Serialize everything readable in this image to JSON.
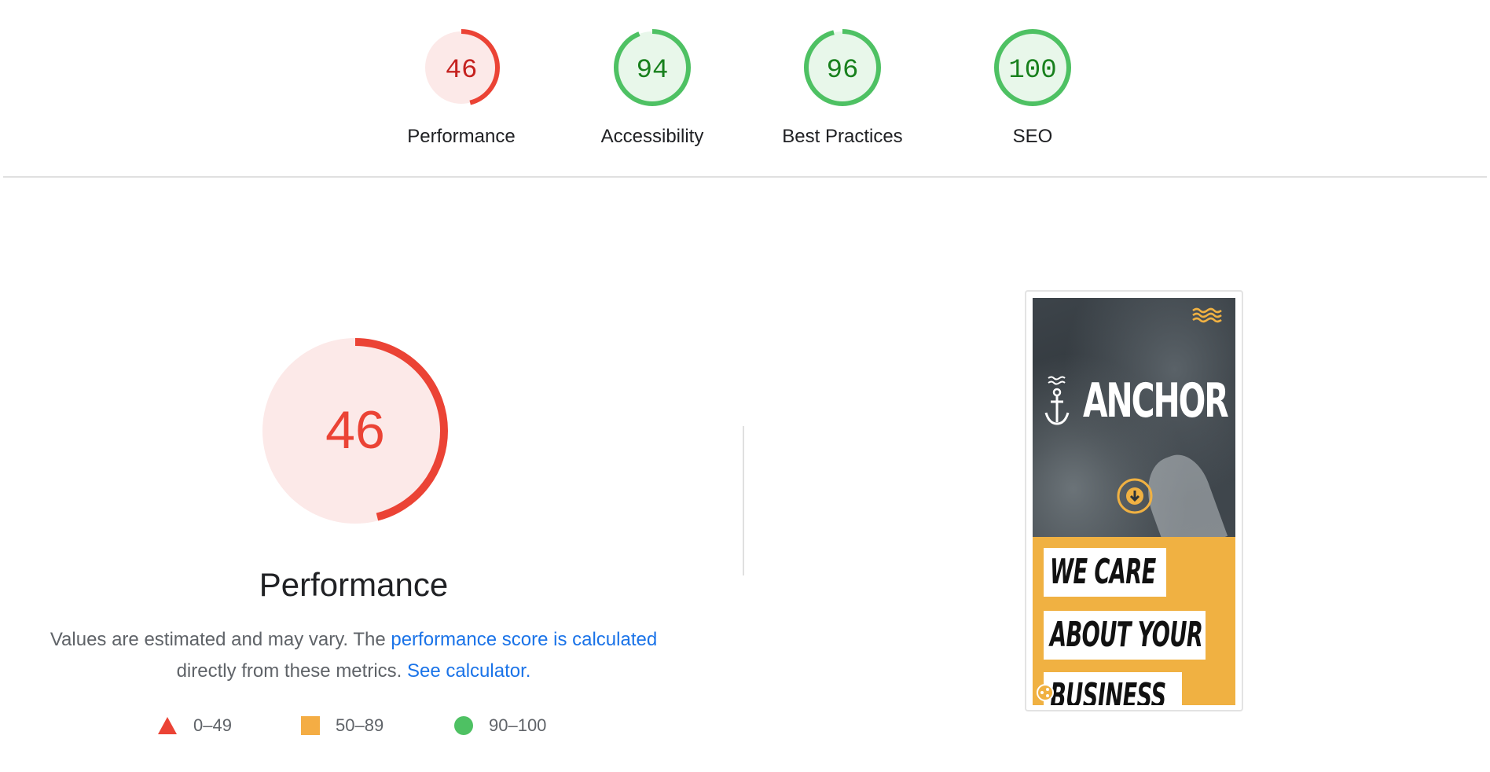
{
  "gauges": [
    {
      "label": "Performance",
      "score": "46",
      "value": 46,
      "status": "fail"
    },
    {
      "label": "Accessibility",
      "score": "94",
      "value": 94,
      "status": "pass"
    },
    {
      "label": "Best Practices",
      "score": "96",
      "value": 96,
      "status": "pass"
    },
    {
      "label": "SEO",
      "score": "100",
      "value": 100,
      "status": "pass"
    }
  ],
  "performance": {
    "score": "46",
    "value": 46,
    "title": "Performance",
    "desc_prefix": "Values are estimated and may vary. The ",
    "desc_link1": "performance score is calculated",
    "desc_middle": "directly from these metrics. ",
    "desc_link2": "See calculator."
  },
  "legend": [
    {
      "shape": "triangle",
      "range": "0–49",
      "color": "#eb4335"
    },
    {
      "shape": "square",
      "range": "50–89",
      "color": "#f4ad44"
    },
    {
      "shape": "circle",
      "range": "90–100",
      "color": "#4ec163"
    }
  ],
  "colors": {
    "fail": "#eb4335",
    "fail_bg": "#fce9e8",
    "fail_text": "#c5221f",
    "pass": "#4ec163",
    "pass_bg": "#e8f7ea",
    "pass_text": "#18801d",
    "link": "#1a73e8"
  },
  "thumbnail": {
    "brand": "ANCHOR",
    "tagline": [
      "WE CARE",
      "ABOUT YOUR",
      "BUSINESS"
    ],
    "accent": "#f0b142"
  }
}
